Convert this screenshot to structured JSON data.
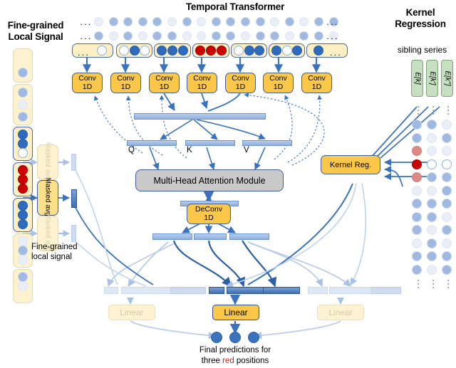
{
  "figure": {
    "titles": {
      "center": "Temporal Transformer",
      "left_line1": "Fine-grained",
      "left_line2": "Local Signal",
      "right_line1": "Kernel",
      "right_line2": "Regression",
      "right_sub": "sibling series"
    },
    "captions": {
      "left_legend_line1": "Fine-grained",
      "left_legend_line2": "local signal",
      "bottom_line1": "Final predictions for",
      "bottom_line2_pre": "three ",
      "bottom_line2_red": "red",
      "bottom_line2_post": " positions"
    },
    "blocks": {
      "conv_line1": "Conv",
      "conv_line2": "1D",
      "deconv_line1": "DeConv",
      "deconv_line2": "1D",
      "attention": "Multi-Head Attention Module",
      "kernel_reg": "Kernel Reg.",
      "masked_avg": "Masked avg.",
      "linear": "Linear"
    },
    "qkv": [
      "Q",
      "K",
      "V"
    ],
    "sibling_labels": [
      "E[k]",
      "E[k']",
      "E[k'']"
    ],
    "ellipsis": "···",
    "colors": {
      "accent_yellow": "#fbc748",
      "token_yellow": "#fbe08a",
      "blue": "#3a72bd",
      "pale_blue": "#9fb9e0",
      "red": "#cc0000",
      "green": "#c6dfc0",
      "gray_module": "#c9c9c9",
      "border_blue": "#3f5f98"
    },
    "token_row": {
      "groups": [
        {
          "dots": [
            "ellipsis",
            "white"
          ]
        },
        {
          "dots": [
            "white",
            "strong",
            "white"
          ]
        },
        {
          "dots": [
            "strong",
            "strong",
            "strong"
          ]
        },
        {
          "dots": [
            "red",
            "red",
            "red"
          ]
        },
        {
          "dots": [
            "white",
            "strong",
            "strong"
          ]
        },
        {
          "dots": [
            "strong",
            "white",
            "strong"
          ]
        },
        {
          "dots": [
            "strong",
            "ellipsis"
          ]
        }
      ],
      "conv_count": 7
    },
    "context_rows": [
      [
        "pale",
        "blue",
        "blue",
        "blue",
        "blue",
        "pale",
        "blue",
        "pale",
        "blue",
        "blue",
        "blue",
        "blue",
        "pale",
        "blue",
        "pale",
        "blue",
        "blue"
      ],
      [
        "blue",
        "pale",
        "blue",
        "pale",
        "blue",
        "blue",
        "pale",
        "pale",
        "blue",
        "blue",
        "pale",
        "blue",
        "blue",
        "pale",
        "blue",
        "blue",
        "pale"
      ]
    ],
    "left_strip": {
      "segments": [
        {
          "highlight": false,
          "dots": [
            "none",
            "blue"
          ]
        },
        {
          "highlight": false,
          "dots": [
            "blue",
            "pale",
            "blue"
          ]
        },
        {
          "highlight": true,
          "dots": [
            "strong",
            "strong",
            "white"
          ]
        },
        {
          "highlight": true,
          "dots": [
            "red",
            "red",
            "red"
          ]
        },
        {
          "highlight": true,
          "dots": [
            "strong",
            "strong",
            "strong"
          ]
        },
        {
          "highlight": false,
          "dots": [
            "pale",
            "blue",
            "pale"
          ]
        },
        {
          "highlight": false,
          "dots": [
            "blue",
            "pale",
            "none"
          ]
        }
      ]
    },
    "right_grid": {
      "columns": 3,
      "rows": [
        [
          "blue",
          "blue",
          "pale"
        ],
        [
          "blue",
          "pale",
          "blue"
        ],
        [
          "redpale",
          "pale",
          "pale"
        ],
        [
          "red",
          "white",
          "white"
        ],
        [
          "redpale",
          "blue",
          "blue"
        ],
        [
          "pale",
          "pale",
          "blue"
        ],
        [
          "blue",
          "blue",
          "blue"
        ],
        [
          "blue",
          "blue",
          "pale"
        ],
        [
          "blue",
          "pale",
          "blue"
        ],
        [
          "pale",
          "blue",
          "pale"
        ],
        [
          "blue",
          "blue",
          "blue"
        ],
        [
          "blue",
          "pale",
          "blue"
        ]
      ]
    }
  }
}
